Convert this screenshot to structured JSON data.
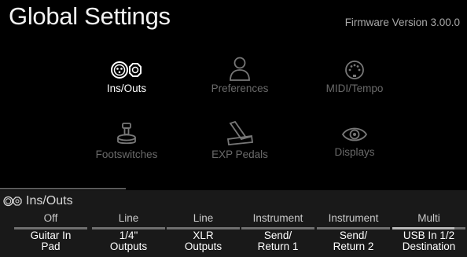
{
  "header": {
    "title": "Global Settings",
    "firmware": "Firmware Version 3.00.0"
  },
  "menu": [
    {
      "label": "Ins/Outs",
      "icon": "ins-outs-icon",
      "selected": true
    },
    {
      "label": "Preferences",
      "icon": "person-icon",
      "selected": false
    },
    {
      "label": "MIDI/Tempo",
      "icon": "midi-icon",
      "selected": false
    },
    {
      "label": "Footswitches",
      "icon": "footswitch-icon",
      "selected": false
    },
    {
      "label": "EXP Pedals",
      "icon": "expression-pedal-icon",
      "selected": false
    },
    {
      "label": "Displays",
      "icon": "eye-icon",
      "selected": false
    }
  ],
  "panel": {
    "title": "Ins/Outs",
    "icon": "ins-outs-icon",
    "params": [
      {
        "value": "Off",
        "name_line1": "Guitar In",
        "name_line2": "Pad",
        "level": 0.0
      },
      {
        "value": "Line",
        "name_line1": "1/4\"",
        "name_line2": "Outputs",
        "level": 0.0
      },
      {
        "value": "Line",
        "name_line1": "XLR",
        "name_line2": "Outputs",
        "level": 0.0
      },
      {
        "value": "Instrument",
        "name_line1": "Send/",
        "name_line2": "Return 1",
        "level": 0.0
      },
      {
        "value": "Instrument",
        "name_line1": "Send/",
        "name_line2": "Return 2",
        "level": 0.0
      },
      {
        "value": "Multi",
        "name_line1": "USB In 1/2",
        "name_line2": "Destination",
        "level": 0.85
      }
    ]
  },
  "colors": {
    "background": "#000000",
    "panel": "#191919",
    "dim_label": "#6a6a6a"
  }
}
